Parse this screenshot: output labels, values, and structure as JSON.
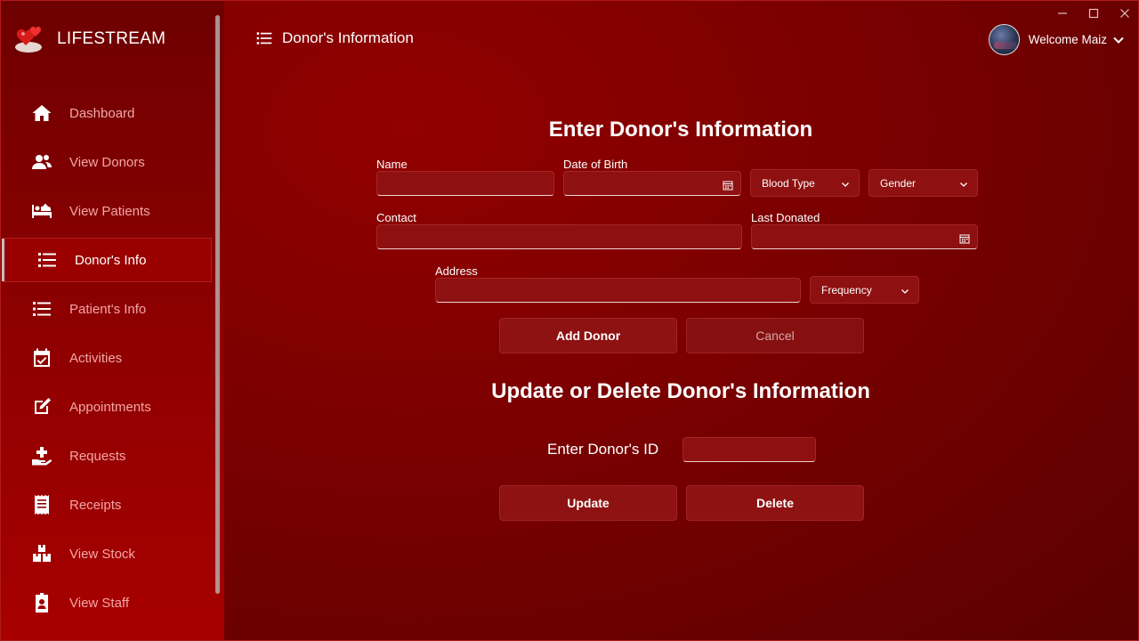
{
  "app": {
    "name": "LIFESTREAM"
  },
  "sidebar": {
    "items": [
      {
        "label": "Dashboard",
        "icon": "home-icon"
      },
      {
        "label": "View Donors",
        "icon": "users-icon"
      },
      {
        "label": "View Patients",
        "icon": "bed-icon"
      },
      {
        "label": "Donor's Info",
        "icon": "list-icon",
        "active": true
      },
      {
        "label": "Patient's Info",
        "icon": "list-icon"
      },
      {
        "label": "Activities",
        "icon": "calendar-check-icon"
      },
      {
        "label": "Appointments",
        "icon": "edit-icon"
      },
      {
        "label": "Requests",
        "icon": "hand-plus-icon"
      },
      {
        "label": "Receipts",
        "icon": "receipt-icon"
      },
      {
        "label": "View Stock",
        "icon": "boxes-icon"
      },
      {
        "label": "View Staff",
        "icon": "id-badge-icon"
      }
    ]
  },
  "header": {
    "title": "Donor's Information",
    "welcome": "Welcome Maiz"
  },
  "form": {
    "heading": "Enter Donor's Information",
    "name_label": "Name",
    "name_value": "",
    "dob_label": "Date of Birth",
    "dob_value": "",
    "blood_type": "Blood Type",
    "gender": "Gender",
    "contact_label": "Contact",
    "contact_value": "",
    "last_donated_label": "Last Donated",
    "last_donated_value": "",
    "address_label": "Address",
    "address_value": "",
    "frequency": "Frequency",
    "add_button": "Add Donor",
    "cancel_button": "Cancel"
  },
  "update": {
    "heading": "Update or Delete Donor's Information",
    "id_label": "Enter Donor's ID",
    "id_value": "",
    "update_button": "Update",
    "delete_button": "Delete"
  },
  "colors": {
    "sidebar_top": "#6e0000",
    "sidebar_bottom": "#a80000",
    "main_bg": "#7a0000",
    "nav_label": "#f4a6a6",
    "input_bg": "#8e1010"
  }
}
